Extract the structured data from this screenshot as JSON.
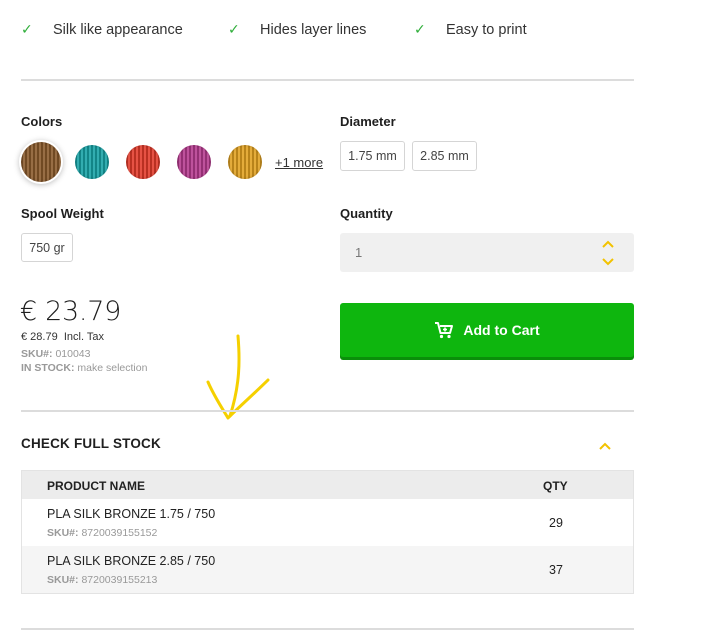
{
  "features": [
    {
      "icon": "check-icon",
      "text": "Silk like appearance"
    },
    {
      "icon": "check-icon",
      "text": "Hides layer lines"
    },
    {
      "icon": "check-icon",
      "text": "Easy to print"
    }
  ],
  "colors": {
    "label": "Colors",
    "swatches": [
      {
        "name": "bronze",
        "color": "#8a5a2b",
        "selected": true
      },
      {
        "name": "teal",
        "color": "#16a2a5"
      },
      {
        "name": "red",
        "color": "#e23a2a"
      },
      {
        "name": "magenta",
        "color": "#b53a8e"
      },
      {
        "name": "gold",
        "color": "#e0a020"
      }
    ],
    "more_link": "+1 more"
  },
  "diameter": {
    "label": "Diameter",
    "options": [
      "1.75 mm",
      "2.85 mm"
    ]
  },
  "spool_weight": {
    "label": "Spool Weight",
    "options": [
      "750 gr"
    ]
  },
  "quantity": {
    "label": "Quantity",
    "value": "1"
  },
  "price": {
    "main": "€ 23.79",
    "incl_value": "€ 28.79",
    "incl_label": "Incl. Tax",
    "sku_label": "SKU#:",
    "sku_value": "010043",
    "stock_label": "IN STOCK:",
    "stock_value": "make selection"
  },
  "cart": {
    "label": "Add to Cart",
    "color": "#0eb60e"
  },
  "stock": {
    "title": "CHECK FULL STOCK",
    "toggle_color": "#f2c200",
    "columns": [
      "PRODUCT NAME",
      "QTY"
    ],
    "rows": [
      {
        "name": "PLA SILK BRONZE 1.75 / 750",
        "sku_label": "SKU#:",
        "sku": "8720039155152",
        "qty": "29"
      },
      {
        "name": "PLA SILK BRONZE 2.85 / 750",
        "sku_label": "SKU#:",
        "sku": "8720039155213",
        "qty": "37"
      }
    ]
  },
  "annotation": {
    "color": "#f5d000"
  }
}
